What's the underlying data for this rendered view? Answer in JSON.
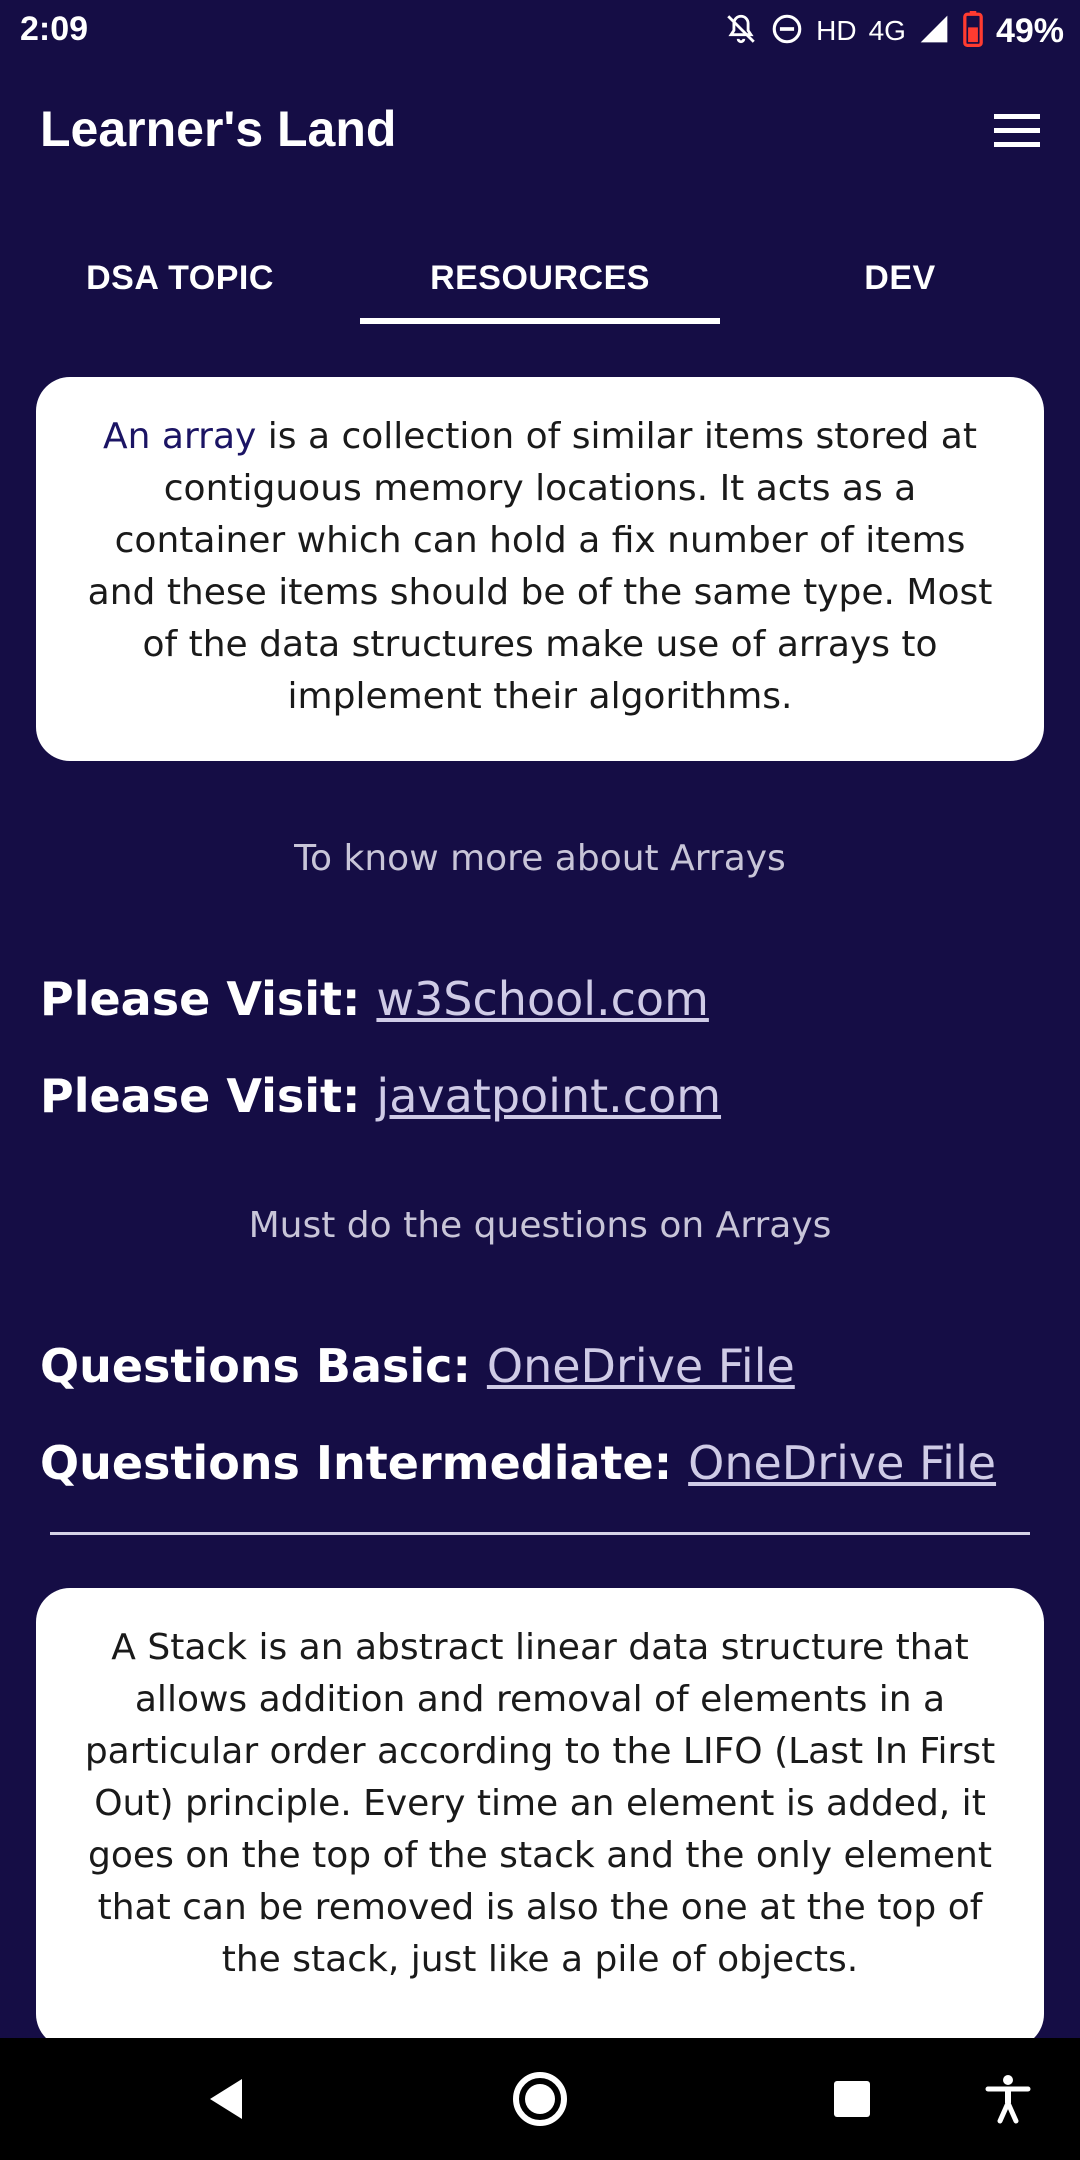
{
  "status_bar": {
    "time": "2:09",
    "network_hd": "HD",
    "network_4g": "4G",
    "battery": "49%"
  },
  "app_bar": {
    "title": "Learner's Land",
    "menu_icon": "hamburger-menu-icon"
  },
  "tabs": [
    {
      "label": "DSA TOPIC",
      "selected": false
    },
    {
      "label": "RESOURCES",
      "selected": true
    },
    {
      "label": "DEV",
      "selected": false
    }
  ],
  "array_section": {
    "card_highlight": "An array",
    "card_text": " is a collection of similar items stored at contiguous memory locations. It acts as a container which can hold a fix number of items and these items should be of the same type. Most of the data structures make use of arrays to implement their algorithms.",
    "know_more": "To know more about Arrays",
    "visit_prefix": "Please Visit: ",
    "links": [
      "w3School.com",
      "javatpoint.com"
    ],
    "questions_heading": "Must do the questions on Arrays",
    "questions": [
      {
        "label": "Questions Basic: ",
        "link": "OneDrive File"
      },
      {
        "label": "Questions Intermediate: ",
        "link": "OneDrive File"
      }
    ]
  },
  "stack_section": {
    "card_text": "A Stack is an abstract linear data structure that allows addition and removal of elements in a particular order according to the LIFO (Last In First Out) principle. Every time an element is added, it goes on the top of the stack and the only element that can be removed is also the one at the top of the stack, just like a pile of objects."
  },
  "colors": {
    "background": "#150d45",
    "card": "#ffffff",
    "accent": "#1b1464",
    "link": "#cfcbe6"
  }
}
